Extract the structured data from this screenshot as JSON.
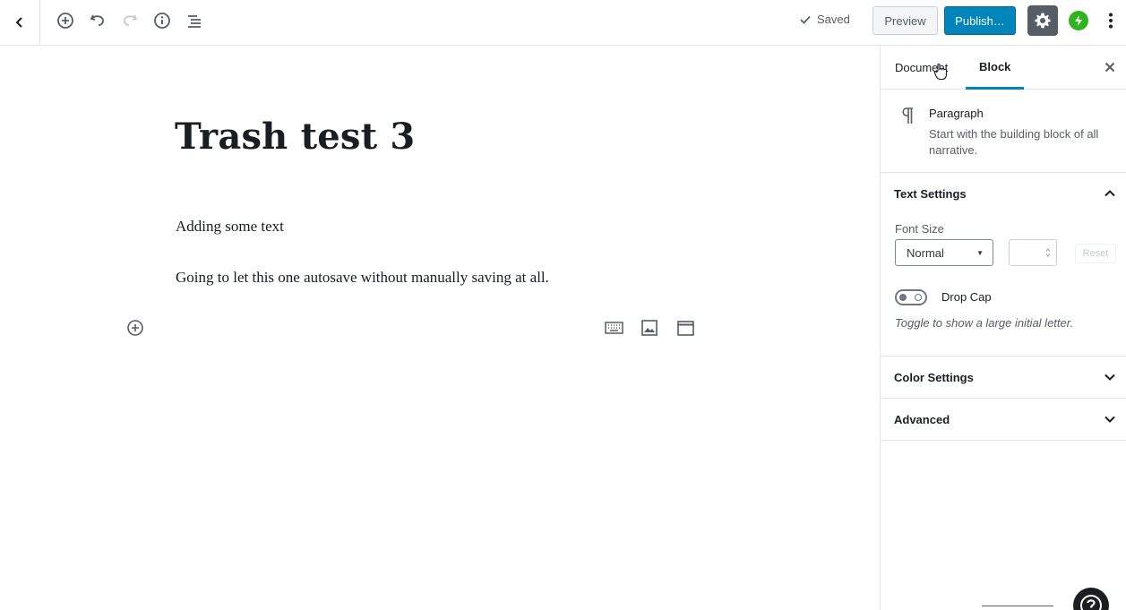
{
  "toolbar": {
    "saved_label": "Saved",
    "preview_label": "Preview",
    "publish_label": "Publish…",
    "accent_color": "#0085ba"
  },
  "editor": {
    "title": "Trash test 3",
    "paragraphs": [
      "Adding some text",
      "Going to let this one autosave without manually saving at all."
    ]
  },
  "sidebar": {
    "tabs": [
      {
        "label": "Document",
        "active": false
      },
      {
        "label": "Block",
        "active": true
      }
    ],
    "block_card": {
      "icon": "paragraph-icon",
      "title": "Paragraph",
      "description": "Start with the building block of all narrative."
    },
    "text_settings": {
      "title": "Text Settings",
      "expanded": true,
      "font_size_label": "Font Size",
      "font_size_value": "Normal",
      "custom_size_value": "",
      "reset_label": "Reset",
      "drop_cap_label": "Drop Cap",
      "drop_cap_enabled": false,
      "drop_cap_help": "Toggle to show a large initial letter."
    },
    "color_settings": {
      "title": "Color Settings",
      "expanded": false
    },
    "advanced": {
      "title": "Advanced",
      "expanded": false
    }
  }
}
